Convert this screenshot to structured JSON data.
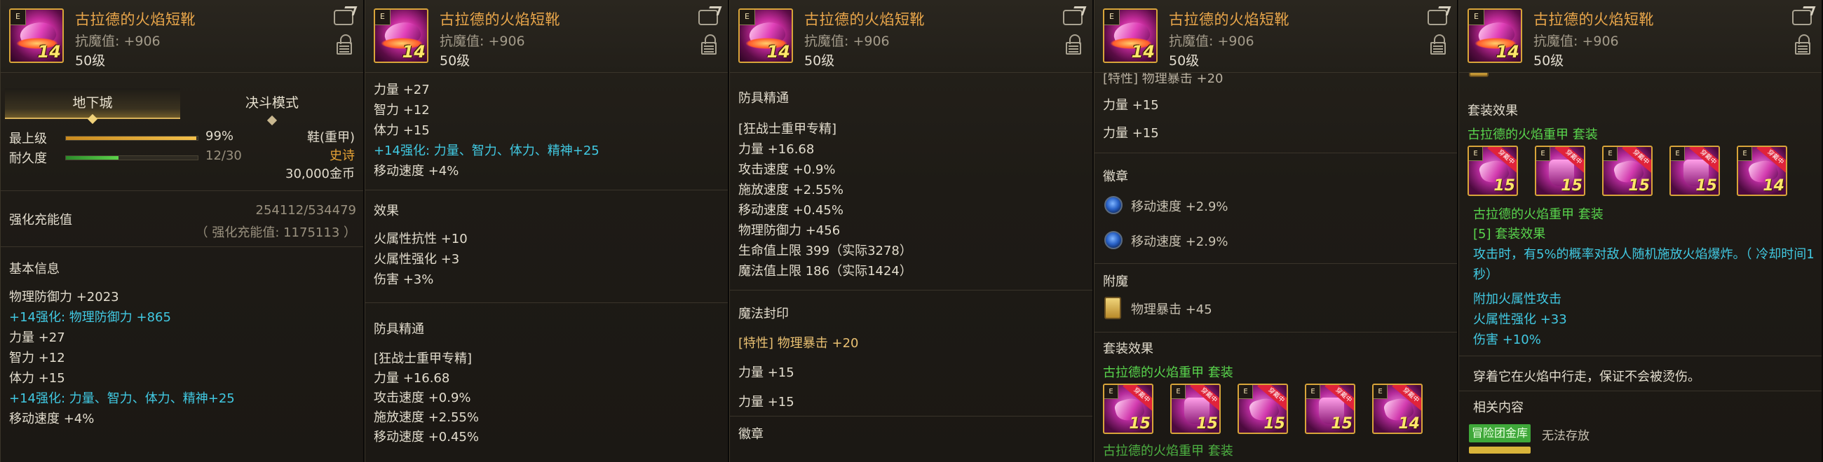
{
  "item": {
    "name": "古拉德的火焰短靴",
    "resist": "抗魔值: +906",
    "level": "50级",
    "icon_corner": "E",
    "icon_level": "14"
  },
  "icons": {
    "share": "share-icon",
    "lock": "lock-icon"
  },
  "panel1": {
    "tab_dungeon": "地下城",
    "tab_duel": "决斗模式",
    "top_level_label": "最上级",
    "top_level_pct": "99%",
    "top_level_value": 0.99,
    "durability_label": "耐久度",
    "durability_value": "12/30",
    "durability_fill": 0.4,
    "slot_type": "鞋(重甲)",
    "rarity": "史诗",
    "price": "30,000金币",
    "charge_label": "强化充能值",
    "charge_value": "254112/534479",
    "charge_sub": "（ 强化充能值: 1175113 ）",
    "basic_title": "基本信息",
    "lines": [
      {
        "text": "物理防御力 +2023",
        "cls": ""
      },
      {
        "text": "+14强化: 物理防御力 +865",
        "cls": "cy"
      },
      {
        "text": "力量 +27",
        "cls": ""
      },
      {
        "text": "智力 +12",
        "cls": ""
      },
      {
        "text": "体力 +15",
        "cls": ""
      },
      {
        "text": "+14强化: 力量、智力、体力、精神+25",
        "cls": "cy"
      },
      {
        "text": "移动速度 +4%",
        "cls": ""
      }
    ]
  },
  "panel2": {
    "top_lines": [
      {
        "text": "力量 +27",
        "cls": ""
      },
      {
        "text": "智力 +12",
        "cls": ""
      },
      {
        "text": "体力 +15",
        "cls": ""
      },
      {
        "text": "+14强化: 力量、智力、体力、精神+25",
        "cls": "cy"
      },
      {
        "text": "移动速度 +4%",
        "cls": ""
      }
    ],
    "effect_title": "效果",
    "effect_lines": [
      "火属性抗性 +10",
      "火属性强化 +3",
      "伤害 +3%"
    ],
    "mastery_title": "防具精通",
    "mastery_lines": [
      "[狂战士重甲专精]",
      "力量 +16.68",
      "攻击速度 +0.9%",
      "施放速度 +2.55%",
      "移动速度 +0.45%"
    ]
  },
  "panel3": {
    "mastery_title": "防具精通",
    "mastery_lines": [
      "[狂战士重甲专精]",
      "力量 +16.68",
      "攻击速度 +0.9%",
      "施放速度 +2.55%",
      "移动速度 +0.45%",
      "物理防御力 +456",
      "生命值上限 399（实际3278）",
      "魔法值上限 186（实际1424）"
    ],
    "seal_title": "魔法封印",
    "seal_trait": "[特性] 物理暴击 +20",
    "seal_lines": [
      "力量 +15",
      "力量 +15"
    ],
    "emblem_title": "徽章"
  },
  "panel4": {
    "top_partial": "[特性] 物理暴击 +20",
    "lines": [
      "力量 +15",
      "力量 +15"
    ],
    "emblem_title": "徽章",
    "emblems": [
      "移动速度 +2.9%",
      "移动速度 +2.9%"
    ],
    "enchant_title": "附魔",
    "enchant": "物理暴击 +45",
    "set_title": "套装效果",
    "set_name": "古拉德的火焰重甲",
    "set_suffix": "套装",
    "set_levels": [
      "15",
      "15",
      "15",
      "15",
      "14"
    ],
    "set_ribbon": "穿戴中",
    "bottom_partial": "古拉德的火焰重甲 套装"
  },
  "panel5": {
    "set_title": "套装效果",
    "set_name": "古拉德的火焰重甲",
    "set_suffix": "套装",
    "set_levels": [
      "15",
      "15",
      "15",
      "15",
      "14"
    ],
    "set_ribbon": "穿戴中",
    "set_name_line": "古拉德的火焰重甲",
    "set_name_line_suffix": "套装",
    "set5": "[5] 套装效果",
    "desc1": "攻击时，有5%的概率对敌人随机施放火焰爆炸。（ 冷却时间1",
    "desc2": "秒）",
    "extra": [
      "附加火属性攻击",
      "火属性强化 +33",
      "伤害 +10%"
    ],
    "flavor": "穿着它在火焰中行走，保证不会被烫伤。",
    "related_title": "相关内容",
    "tag": "冒险团金库",
    "tag_note": "无法存放"
  },
  "colors": {
    "orange": "#e9a64a",
    "cyan": "#41c9e2",
    "green": "#59d64d",
    "gold": "#e9c072"
  }
}
